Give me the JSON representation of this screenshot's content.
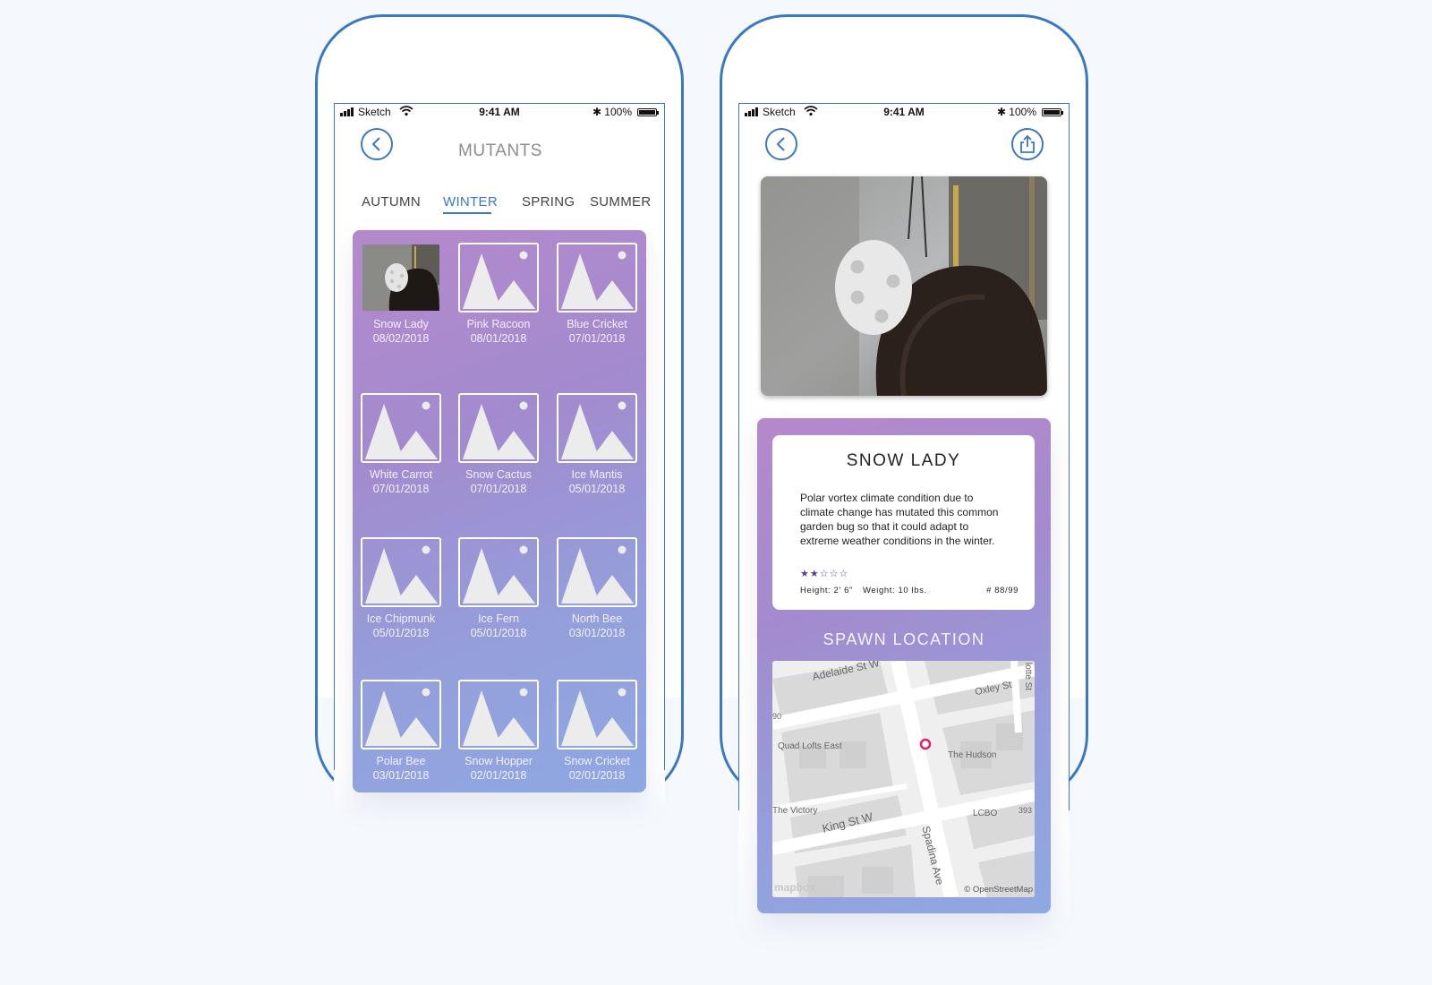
{
  "status_bar": {
    "carrier": "Sketch",
    "time": "9:41 AM",
    "battery": "100%"
  },
  "list_screen": {
    "title": "MUTANTS",
    "tabs": [
      {
        "label": "AUTUMN",
        "active": false
      },
      {
        "label": "WINTER",
        "active": true
      },
      {
        "label": "SPRING",
        "active": false
      },
      {
        "label": "SUMMER",
        "active": false
      }
    ],
    "items": [
      {
        "name": "Snow Lady",
        "date": "08/02/2018",
        "has_photo": true
      },
      {
        "name": "Pink Racoon",
        "date": "08/01/2018"
      },
      {
        "name": "Blue Cricket",
        "date": "07/01/2018"
      },
      {
        "name": "White Carrot",
        "date": "07/01/2018"
      },
      {
        "name": "Snow Cactus",
        "date": "07/01/2018"
      },
      {
        "name": "Ice Mantis",
        "date": "05/01/2018"
      },
      {
        "name": "Ice Chipmunk",
        "date": "05/01/2018"
      },
      {
        "name": "Ice Fern",
        "date": "05/01/2018"
      },
      {
        "name": "North Bee",
        "date": "03/01/2018"
      },
      {
        "name": "Polar Bee",
        "date": "03/01/2018"
      },
      {
        "name": "Snow Hopper",
        "date": "02/01/2018"
      },
      {
        "name": "Snow Cricket",
        "date": "02/01/2018"
      }
    ]
  },
  "detail_screen": {
    "name": "SNOW LADY",
    "description": "Polar vortex climate condition due to climate change has mutated this common garden bug so that it could adapt to extreme weather conditions in the winter.",
    "rating": 2,
    "rating_max": 5,
    "rating_stars": "★★☆☆☆",
    "height": "Height: 2' 6\"",
    "weight": "Weight: 10 lbs.",
    "number": "# 88/99",
    "spawn_title": "SPAWN LOCATION",
    "map_labels": {
      "adelaide": "Adelaide St W",
      "oxley": "Oxley St",
      "charlotte": "lotte St",
      "quad": "Quad Lofts East",
      "hudson": "The Hudson",
      "victory": "The Victory",
      "king": "King St W",
      "lcbo": "LCBO",
      "spadina": "Spadina Ave",
      "num393": "393",
      "num90": "90",
      "mapbox": "mapbox",
      "osm": "© OpenStreetMap"
    }
  },
  "icons": {
    "back": "chevron-left-icon",
    "share": "share-icon",
    "placeholder": "image-placeholder-icon",
    "pin": "map-pin-icon"
  },
  "colors": {
    "accent": "#3c78c0",
    "gradient_top": "#b589cc",
    "gradient_bottom": "#8fa8e2",
    "pin": "#e0206e"
  }
}
